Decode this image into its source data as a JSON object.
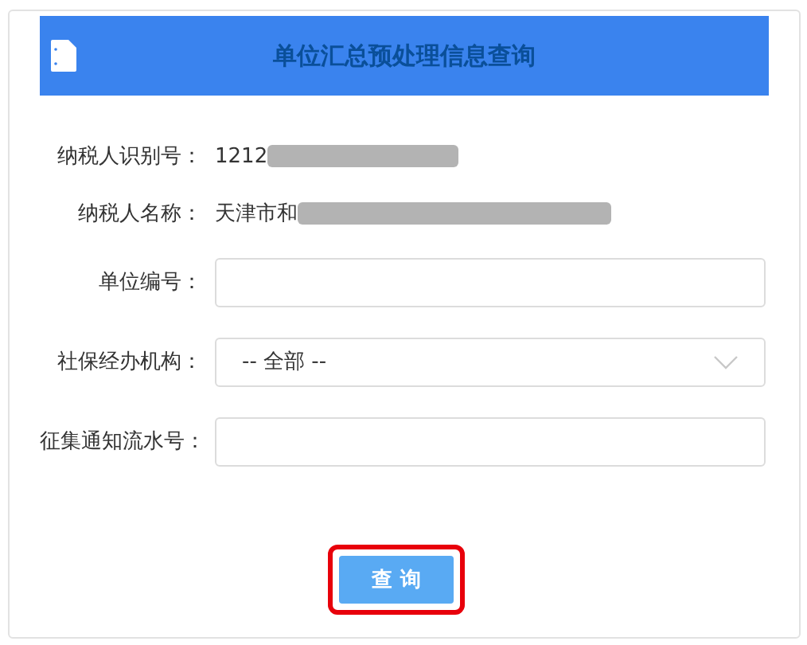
{
  "header": {
    "title": "单位汇总预处理信息查询"
  },
  "info_rows": [
    {
      "label": "纳税人识别号：",
      "value": "1212",
      "redacted": true
    },
    {
      "label": "纳税人名称：",
      "value": "天津市和",
      "redacted": true
    }
  ],
  "fields": [
    {
      "kind": "text",
      "label": "单位编号："
    },
    {
      "kind": "select",
      "label": "社保经办机构：",
      "value": "-- 全部 --"
    },
    {
      "kind": "text",
      "label": "征集通知流水号："
    }
  ],
  "button": {
    "label": "查 询",
    "highlighted": true
  }
}
